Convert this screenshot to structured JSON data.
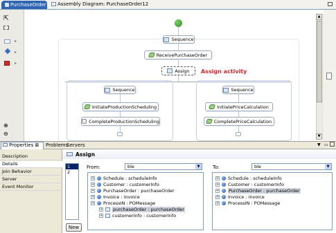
{
  "editor_tabs": [
    {
      "label": "PurchaseOrder",
      "active": true
    },
    {
      "label": "Assembly Diagram: PurchaseOrder12",
      "active": false
    }
  ],
  "diagram": {
    "outer_sequence": "Sequence",
    "receive": "ReceivePurchaseOrder",
    "assign": "Assign",
    "annotation": "Assign activity",
    "left_branch": {
      "sequence": "Sequence",
      "steps": [
        "InitiateProductionScheduling",
        "CompleteProductionScheduling"
      ]
    },
    "right_branch": {
      "sequence": "Sequence",
      "steps": [
        "InitiatePriceCalculation",
        "CompletePriceCalculation"
      ]
    }
  },
  "bottom_tabs": [
    "Properties",
    "Problems",
    "Servers"
  ],
  "properties": {
    "title": "Assign",
    "sections": [
      "Description",
      "Details",
      "Join Behavior",
      "Server",
      "Event Monitor"
    ],
    "selected_section": "Details",
    "row_numbers": [
      "1",
      "2"
    ],
    "new_button": "New",
    "from": {
      "label": "From:",
      "value": "ble",
      "tree": [
        {
          "text": "Schedule : scheduleInfo",
          "level": 0,
          "icon": "variable-icon"
        },
        {
          "text": "Customer : customerInfo",
          "level": 0,
          "icon": "variable-icon"
        },
        {
          "text": "PurchaseOrder : purchaseOrder",
          "level": 0,
          "icon": "variable-icon"
        },
        {
          "text": "Invoice : invoice",
          "level": 0,
          "icon": "variable-icon"
        },
        {
          "text": "ProcessIN : POMessage",
          "level": 0,
          "icon": "variable-icon"
        },
        {
          "text": "purchaseOrder : purchaseOrder",
          "level": 1,
          "icon": "message-part-icon",
          "selected": true
        },
        {
          "text": "customerInfo : customerInfo",
          "level": 1,
          "icon": "message-part-icon"
        }
      ]
    },
    "to": {
      "label": "To:",
      "value": "ble",
      "tree": [
        {
          "text": "Schedule : scheduleInfo",
          "level": 0,
          "icon": "variable-icon"
        },
        {
          "text": "Customer : customerInfo",
          "level": 0,
          "icon": "variable-icon"
        },
        {
          "text": "PurchaseOrder : purchaseOrder",
          "level": 0,
          "icon": "variable-icon",
          "selected": true
        },
        {
          "text": "Invoice : invoice",
          "level": 0,
          "icon": "variable-icon"
        },
        {
          "text": "ProcessIN : POMessage",
          "level": 0,
          "icon": "variable-icon"
        }
      ]
    }
  },
  "colors": {
    "annotation": "#d4262b",
    "tab_active": "#2f64b3",
    "selection": "#cfd4dc",
    "panel_bg": "#ece9d8"
  }
}
